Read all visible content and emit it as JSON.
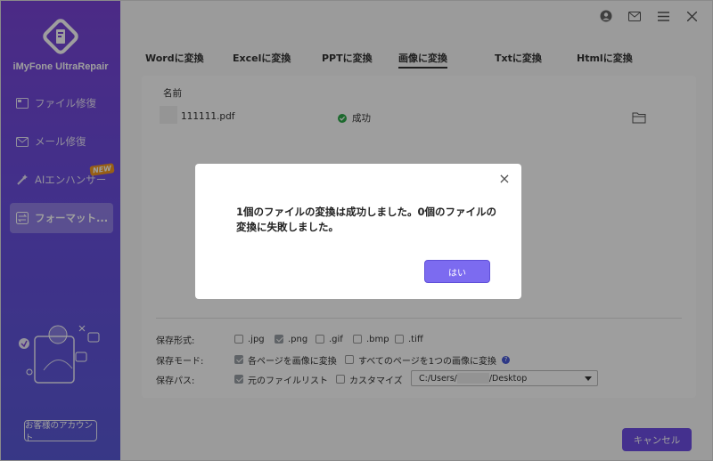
{
  "app": {
    "brand": "iMyFone UltraRepair"
  },
  "sidebar": {
    "items": [
      {
        "label": "ファイル修復",
        "icon": "file-repair-icon"
      },
      {
        "label": "メール修復",
        "icon": "mail-repair-icon"
      },
      {
        "label": "AIエンハンサー",
        "icon": "ai-enhancer-icon",
        "badge": "NEW"
      },
      {
        "label": "フォーマット...",
        "icon": "format-convert-icon",
        "active": true
      }
    ],
    "account_button": "お客様のアカウント"
  },
  "topbar": {
    "icons": [
      "user-icon",
      "mail-icon",
      "menu-icon",
      "close-icon"
    ]
  },
  "tabs": [
    {
      "label": "Wordに変換"
    },
    {
      "label": "Excelに変換"
    },
    {
      "label": "PPTに変換"
    },
    {
      "label": "画像に変換",
      "active": true
    },
    {
      "label": "Txtに変換"
    },
    {
      "label": "Htmlに変換"
    }
  ],
  "file_list": {
    "header_name": "名前",
    "rows": [
      {
        "name": "111111.pdf",
        "status": "成功"
      }
    ]
  },
  "options": {
    "format_label": "保存形式:",
    "formats": [
      {
        "label": ".jpg",
        "checked": false
      },
      {
        "label": ".png",
        "checked": true
      },
      {
        "label": ".gif",
        "checked": false
      },
      {
        "label": ".bmp",
        "checked": false
      },
      {
        "label": ".tiff",
        "checked": false
      }
    ],
    "mode_label": "保存モード:",
    "mode_each": "各ページを画像に変換",
    "mode_one": "すべてのページを1つの画像に変換",
    "path_label": "保存パス:",
    "path_original": "元のファイルリスト",
    "path_custom": "カスタマイズ",
    "path_value_start": "C:/Users/",
    "path_value_end": "/Desktop"
  },
  "cancel_button": "キャンセル",
  "dialog": {
    "message": "1個のファイルの変換は成功しました。0個のファイルの変換に失敗しました。",
    "ok_button": "はい"
  },
  "colors": {
    "accent": "#6e4ee6",
    "sidebar_top": "#7a45d8",
    "sidebar_bottom": "#5a5ad8",
    "success": "#2eaa4a"
  }
}
